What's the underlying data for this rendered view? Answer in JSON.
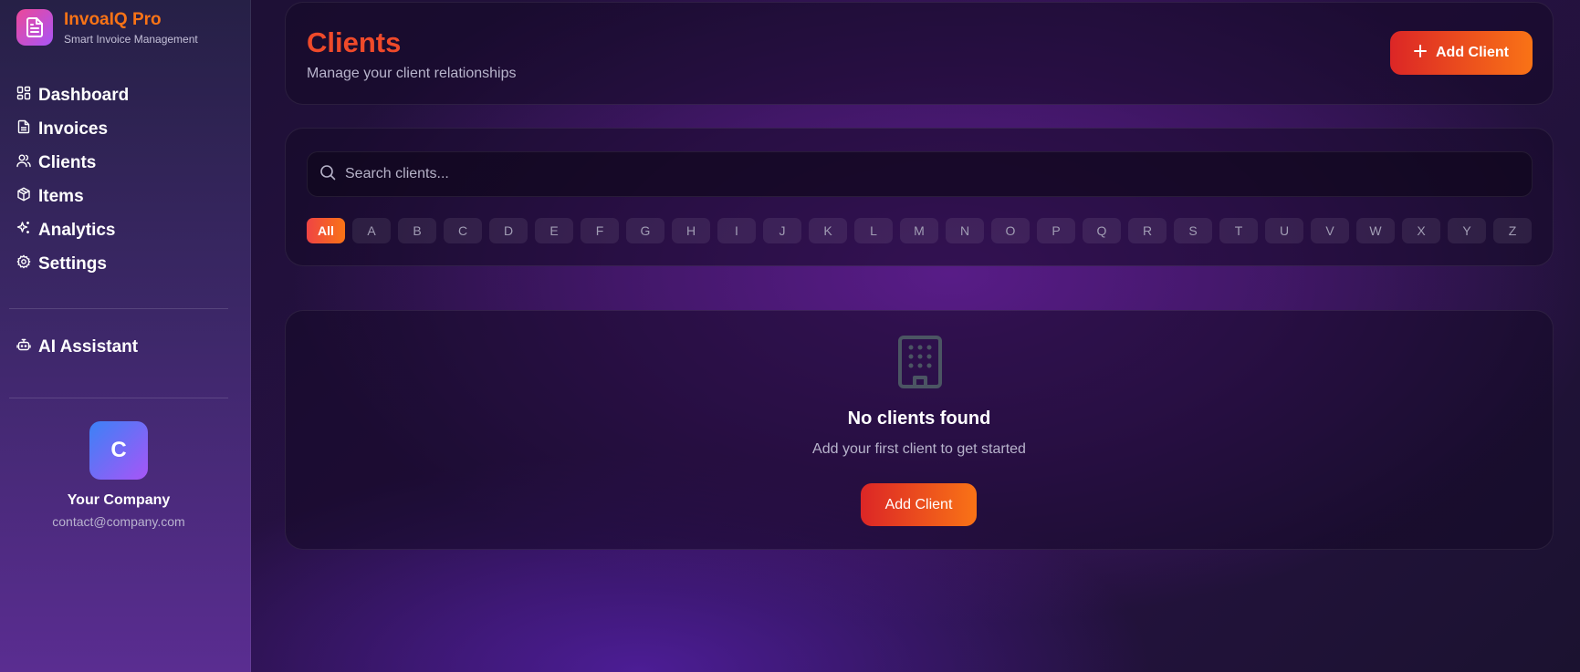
{
  "app": {
    "name": "InvoaIQ Pro",
    "tagline": "Smart Invoice Management"
  },
  "sidebar": {
    "items": [
      {
        "label": "Dashboard",
        "icon": "grid-icon"
      },
      {
        "label": "Invoices",
        "icon": "file-text-icon"
      },
      {
        "label": "Clients",
        "icon": "users-icon"
      },
      {
        "label": "Items",
        "icon": "package-icon"
      },
      {
        "label": "Analytics",
        "icon": "sparkles-icon"
      },
      {
        "label": "Settings",
        "icon": "gear-icon"
      }
    ],
    "assistant": {
      "label": "AI Assistant",
      "icon": "bot-icon"
    },
    "company": {
      "avatar_letter": "C",
      "name": "Your Company",
      "email": "contact@company.com"
    }
  },
  "header": {
    "title": "Clients",
    "subtitle": "Manage your client relationships",
    "add_button": "Add Client"
  },
  "search": {
    "placeholder": "Search clients...",
    "value": ""
  },
  "filters": {
    "letters": [
      "All",
      "A",
      "B",
      "C",
      "D",
      "E",
      "F",
      "G",
      "H",
      "I",
      "J",
      "K",
      "L",
      "M",
      "N",
      "O",
      "P",
      "Q",
      "R",
      "S",
      "T",
      "U",
      "V",
      "W",
      "X",
      "Y",
      "Z"
    ],
    "active": "All"
  },
  "empty_state": {
    "icon": "building-icon",
    "title": "No clients found",
    "subtitle": "Add your first client to get started",
    "button": "Add Client"
  },
  "colors": {
    "accent_start": "#dc2626",
    "accent_end": "#f97316",
    "brand_name": "#f97316",
    "title": "#ef4a2a"
  }
}
